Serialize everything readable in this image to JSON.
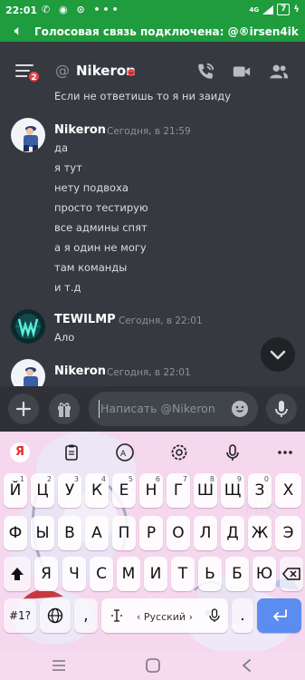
{
  "status_bar": {
    "time": "22:01",
    "network": "4G",
    "battery": "7"
  },
  "voice_banner": {
    "text": "Голосовая связь подключена: @®irsen4ik"
  },
  "header": {
    "badge": "2",
    "at_symbol": "@",
    "channel_name": "Nikeron"
  },
  "messages": {
    "previous_line": "Если не ответишь то я ни заиду",
    "groups": [
      {
        "author": "Nikeron",
        "timestamp": "Сегодня, в 21:59",
        "lines": [
          "да",
          "я тут",
          "нету подвоха",
          "просто тестирую",
          "все админы спят",
          "а я один не могу",
          "там команды",
          "и т.д"
        ]
      },
      {
        "author": "TEWILMP",
        "timestamp": "Сегодня, в 22:01",
        "lines": [
          "Ало"
        ]
      },
      {
        "author": "Nikeron",
        "timestamp": "Сегодня, в 22:01",
        "lines": []
      }
    ]
  },
  "composer": {
    "placeholder": "Написать @Nikeron"
  },
  "keyboard": {
    "row1": [
      "Й",
      "Ц",
      "У",
      "К",
      "Е",
      "Н",
      "Г",
      "Ш",
      "Щ",
      "З",
      "Х"
    ],
    "row1_hints": [
      "1",
      "2",
      "3",
      "4",
      "5",
      "6",
      "7",
      "8",
      "9",
      "0",
      ""
    ],
    "row2": [
      "Ф",
      "Ы",
      "В",
      "А",
      "П",
      "Р",
      "О",
      "Л",
      "Д",
      "Ж",
      "Э"
    ],
    "row3": [
      "Я",
      "Ч",
      "С",
      "М",
      "И",
      "Т",
      "Ь",
      "Б",
      "Ю"
    ],
    "symbols_key": "#1?",
    "comma_key": ",",
    "space_label": "‹ Русский ›",
    "period_key": ".",
    "logo_letter": "Я"
  },
  "colors": {
    "status_green": "#1e9c3e",
    "discord_bg": "#36393f",
    "input_bg": "#2f3136",
    "dnd_red": "#ed4245",
    "keyboard_pink": "#f5d7ee",
    "enter_blue": "#5b8cf0"
  },
  "icons": [
    "menu-icon",
    "at-icon",
    "dnd-status-icon",
    "voice-call-icon",
    "video-call-icon",
    "members-icon",
    "chevron-down-icon",
    "plus-icon",
    "gift-icon",
    "emoji-icon",
    "microphone-icon",
    "yandex-logo-icon",
    "clipboard-icon",
    "translate-icon",
    "settings-icon",
    "dictation-icon",
    "more-icon",
    "shift-icon",
    "backspace-icon",
    "globe-icon",
    "cursor-icon",
    "enter-icon",
    "nav-menu-icon",
    "nav-home-icon",
    "nav-back-icon"
  ]
}
